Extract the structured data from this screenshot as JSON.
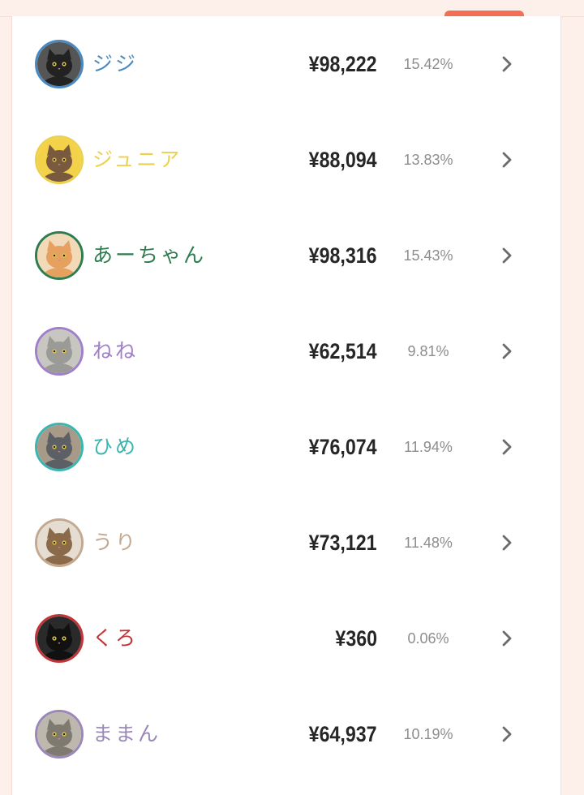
{
  "rows": [
    {
      "name": "ジジ",
      "amount": "¥98,222",
      "percent": "15.42%",
      "color": "#4a88c0",
      "avatar": "black-cat-photo",
      "fur": "#222222",
      "bg": "#555555"
    },
    {
      "name": "ジュニア",
      "amount": "¥88,094",
      "percent": "13.83%",
      "color": "#ecd14c",
      "avatar": "tabby-cat-in-yellow-hood-photo",
      "fur": "#7a5a3e",
      "bg": "#f3d24a"
    },
    {
      "name": "あーちゃん",
      "amount": "¥98,316",
      "percent": "15.43%",
      "color": "#2e7d4f",
      "avatar": "orange-cat-photo",
      "fur": "#e6a060",
      "bg": "#f2d9b8"
    },
    {
      "name": "ねね",
      "amount": "¥62,514",
      "percent": "9.81%",
      "color": "#a080c8",
      "avatar": "silver-tabby-cat-photo",
      "fur": "#9a9a96",
      "bg": "#c8c6c0"
    },
    {
      "name": "ひめ",
      "amount": "¥76,074",
      "percent": "11.94%",
      "color": "#3ab5b0",
      "avatar": "gray-cat-photo",
      "fur": "#5c5f66",
      "bg": "#a89a88"
    },
    {
      "name": "うり",
      "amount": "¥73,121",
      "percent": "11.48%",
      "color": "#c4a890",
      "avatar": "brown-tabby-cat-photo",
      "fur": "#8a6a48",
      "bg": "#e6ddd2"
    },
    {
      "name": "くろ",
      "amount": "¥360",
      "percent": "0.06%",
      "color": "#c03538",
      "avatar": "black-cat-with-red-collar-photo",
      "fur": "#111111",
      "bg": "#2a2a2a"
    },
    {
      "name": "ままん",
      "amount": "¥64,937",
      "percent": "10.19%",
      "color": "#9a88b8",
      "avatar": "gray-tabby-cat-photo",
      "fur": "#7e7a70",
      "bg": "#bdb8ae"
    }
  ],
  "icons": {
    "row_arrow": "chevron-right-icon"
  },
  "colors": {
    "accent_tab": "#f26e55",
    "background": "#fdf0ea",
    "amount_text": "#262626",
    "percent_text": "#8d8d8d",
    "chevron": "#6b6b6b"
  }
}
